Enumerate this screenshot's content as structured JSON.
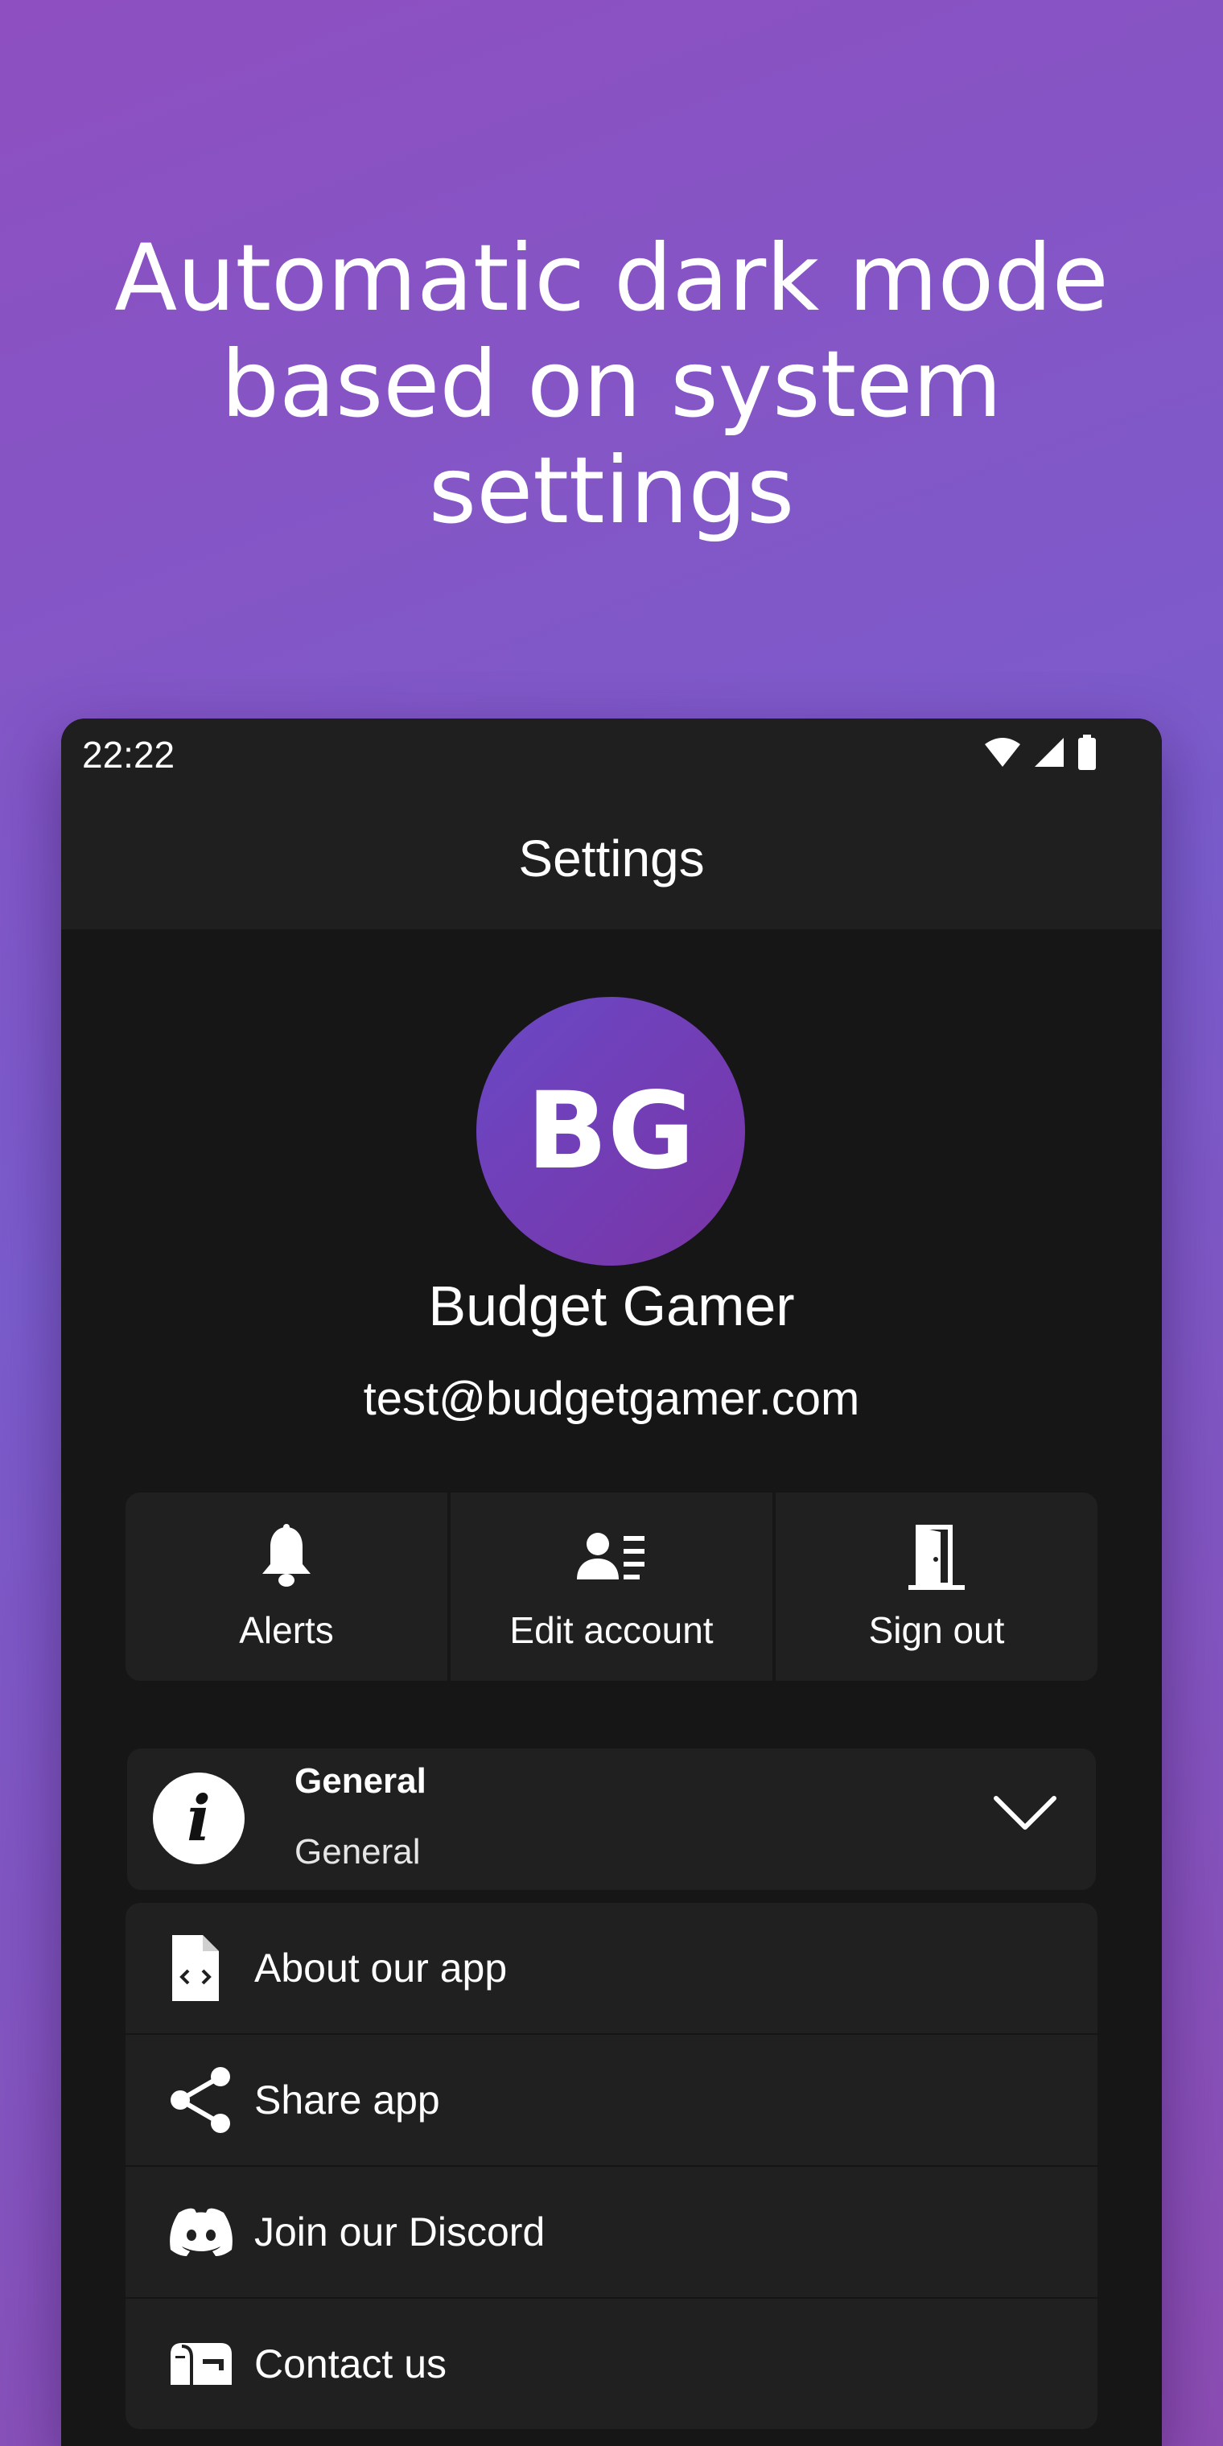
{
  "headline": {
    "line1": "Automatic dark mode",
    "line2": "based on system",
    "line3": "settings"
  },
  "status_bar": {
    "time": "22:22",
    "icons": [
      "wifi-icon",
      "cell-signal-icon",
      "battery-icon"
    ]
  },
  "app_bar": {
    "title": "Settings"
  },
  "profile": {
    "initials": "BG",
    "name": "Budget Gamer",
    "email": "test@budgetgamer.com"
  },
  "actions": [
    {
      "label": "Alerts",
      "icon": "bell-icon"
    },
    {
      "label": "Edit account",
      "icon": "account-edit-icon"
    },
    {
      "label": "Sign out",
      "icon": "door-icon"
    }
  ],
  "general_section": {
    "title": "General",
    "subtitle": "General",
    "icon": "info-icon",
    "expand_icon": "chevron-down-icon"
  },
  "menu": [
    {
      "label": "About our app",
      "icon": "file-code-icon"
    },
    {
      "label": "Share app",
      "icon": "share-icon"
    },
    {
      "label": "Join our Discord",
      "icon": "discord-icon"
    },
    {
      "label": "Contact us",
      "icon": "mailbox-icon"
    }
  ],
  "colors": {
    "background_gradient_start": "#8e4fc0",
    "background_gradient_end": "#7a5ccc",
    "surface": "#161616",
    "card": "#202020",
    "avatar_gradient_start": "#6a48c6",
    "avatar_gradient_end": "#7a34a6"
  }
}
